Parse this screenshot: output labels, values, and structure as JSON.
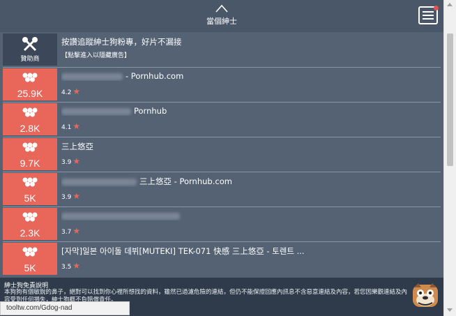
{
  "header": {
    "title": "當個紳士"
  },
  "sponsor": {
    "label": "贊助商",
    "title": "按讚追蹤紳士狗粉專，好片不漏接",
    "subtitle": "【點擊進入以隱藏廣告】"
  },
  "items": [
    {
      "count": "25.9K",
      "title": "- Pornhub.com",
      "rating": "4.2",
      "blur_width": 88
    },
    {
      "count": "2.8K",
      "title": "Pornhub",
      "rating": "4.1",
      "blur_width": 100
    },
    {
      "count": "9.7K",
      "title": "三上悠亞",
      "rating": "3.9",
      "blur_width": 0
    },
    {
      "count": "5K",
      "title": "三上悠亞 - Pornhub.com",
      "rating": "3.9",
      "blur_width": 108
    },
    {
      "count": "2.3K",
      "title": "",
      "rating": "3.7",
      "blur_width": 170
    },
    {
      "count": "5K",
      "title": "[자막]일본 아이돌 데뷔[MUTEKI] TEK-071 快感 三上悠亞 - 토렌트 ...",
      "rating": "3.5",
      "blur_width": 0
    }
  ],
  "disclaimer": {
    "title": "紳士狗免責說明",
    "body": "本狗狗有個敏銳的鼻子，絕對可以找到你心裡所想找的資料，雖然已過濾危險的連結，但仍不能保證回應內訊息不含惡意連結及內容，若您因樂觀連結及內容受到任何損失，紳士狗概不負賠償責任。"
  },
  "status_url": "tooltw.com/Gdog-nad",
  "colors": {
    "accent": "#e8675a",
    "background": "#546274",
    "header": "#4a5769"
  },
  "icons": {
    "menu": "hamburger-icon",
    "up": "chevron-up-icon",
    "eyes": "eyes-icon",
    "star": "star-icon",
    "mascot": "bulldog-mascot-icon"
  }
}
